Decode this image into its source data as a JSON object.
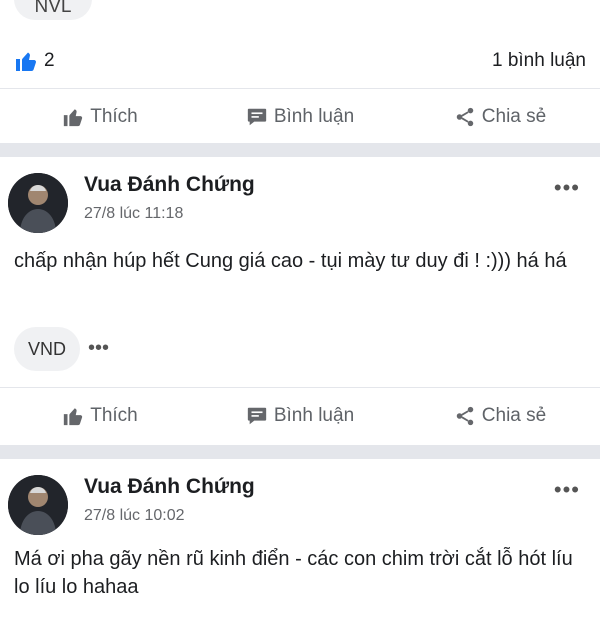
{
  "post0": {
    "tag": "NVL",
    "reaction_count": "2",
    "comments": "1 bình luận",
    "actions": {
      "like": "Thích",
      "comment": "Bình luận",
      "share": "Chia sẻ"
    }
  },
  "post1": {
    "author": "Vua Đánh Chứng",
    "time": "27/8 lúc 11:18",
    "text": "chấp nhận húp hết Cung giá cao - tụi mày tư duy đi ! :))) há há",
    "tag": "VND",
    "tag_more": "•••",
    "more": "•••",
    "actions": {
      "like": "Thích",
      "comment": "Bình luận",
      "share": "Chia sẻ"
    }
  },
  "post2": {
    "author": "Vua Đánh Chứng",
    "time": "27/8 lúc 10:02",
    "text": "Má ơi pha gãy nền rũ kinh điển - các con chim trời cắt lỗ hót líu lo líu lo hahaa",
    "more": "•••"
  },
  "colors": {
    "accent": "#1877f2",
    "divider": "#e4e6eb",
    "muted": "#65676b"
  }
}
